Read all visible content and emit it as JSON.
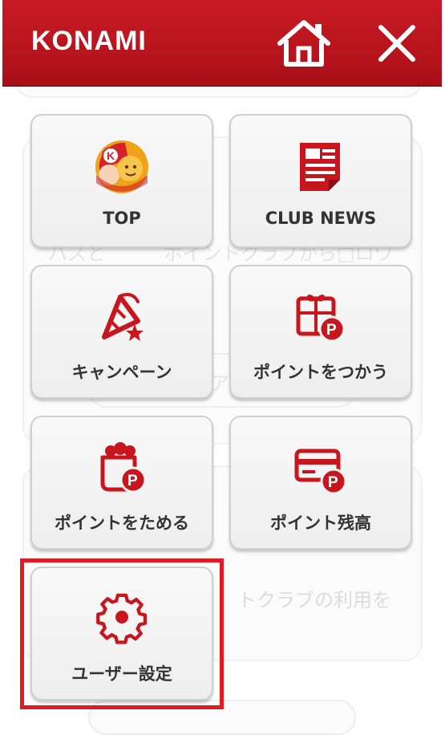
{
  "header": {
    "logo": "KONAMI",
    "home_icon": "home-icon",
    "close_icon": "close-icon"
  },
  "menu": {
    "items": [
      {
        "label": "TOP",
        "icon": "mascot-icon"
      },
      {
        "label": "CLUB NEWS",
        "icon": "newspaper-icon"
      },
      {
        "label": "キャンペーン",
        "icon": "party-popper-star-icon"
      },
      {
        "label": "ポイントをつかう",
        "icon": "gift-point-icon"
      },
      {
        "label": "ポイントをためる",
        "icon": "pouch-point-icon"
      },
      {
        "label": "ポイント残高",
        "icon": "card-point-icon"
      },
      {
        "label": "ユーザー設定",
        "icon": "gear-icon"
      }
    ],
    "highlighted_item": "ユーザー設定"
  },
  "background": {
    "text_1": "ハスと　　　ポイントクラブから□ロワ",
    "text_2": "ア",
    "text_3": "トクラブの利用を"
  },
  "colors": {
    "brand_red": "#b8141d",
    "icon_red": "#c8161f",
    "highlight_red": "#e21a22"
  }
}
